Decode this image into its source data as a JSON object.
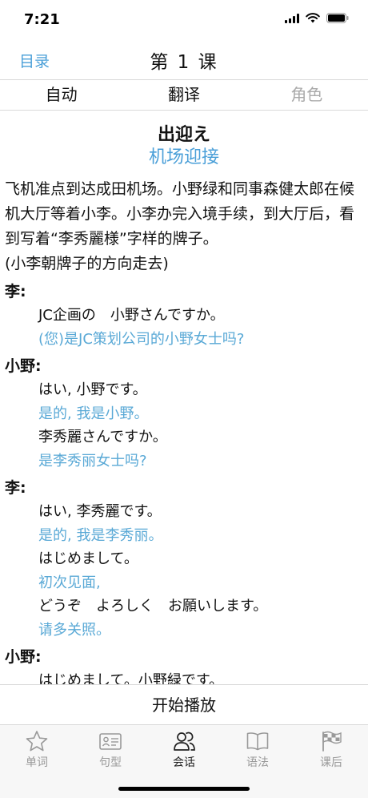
{
  "status": {
    "time": "7:21"
  },
  "nav": {
    "back_label": "目录",
    "title": "第 1 课"
  },
  "segments": [
    {
      "label": "自动",
      "enabled": true
    },
    {
      "label": "翻译",
      "enabled": true
    },
    {
      "label": "角色",
      "enabled": false
    }
  ],
  "lesson": {
    "title": "出迎え",
    "subtitle": "机场迎接",
    "intro": "飞机准点到达成田机场。小野绿和同事森健太郎在候机大厅等着小李。小李办完入境手续，到大厅后，看到写着“李秀麗様”字样的牌子。",
    "stage": "(小李朝牌子的方向走去)",
    "dialogue": [
      {
        "speaker": "李:",
        "lines": [
          {
            "jp": "JC企画の　小野さんですか。",
            "cn": "(您)是JC策划公司的小野女士吗?"
          }
        ]
      },
      {
        "speaker": "小野:",
        "lines": [
          {
            "jp": "はい, 小野です。",
            "cn": "是的, 我是小野。"
          },
          {
            "jp": "李秀麗さんですか。",
            "cn": "是李秀丽女士吗?"
          }
        ]
      },
      {
        "speaker": "李:",
        "lines": [
          {
            "jp": "はい, 李秀麗です。",
            "cn": "是的, 我是李秀丽。"
          },
          {
            "jp": "はじめまして。",
            "cn": "初次见面,"
          },
          {
            "jp": "どうぞ　よろしく　お願いします。",
            "cn": "请多关照。"
          }
        ]
      },
      {
        "speaker": "小野:",
        "lines": [
          {
            "jp": "はじめまして。小野緑です。",
            "cn": ""
          }
        ]
      }
    ]
  },
  "play_label": "开始播放",
  "tabs": [
    {
      "label": "单词",
      "icon": "star-icon",
      "active": false
    },
    {
      "label": "句型",
      "icon": "id-card-icon",
      "active": false
    },
    {
      "label": "会话",
      "icon": "people-icon",
      "active": true
    },
    {
      "label": "语法",
      "icon": "book-icon",
      "active": false
    },
    {
      "label": "课后",
      "icon": "checkered-flag-icon",
      "active": false
    }
  ],
  "colors": {
    "accent": "#4a9fd8",
    "translation": "#5aa9d6",
    "disabled": "#aaaaaa"
  }
}
